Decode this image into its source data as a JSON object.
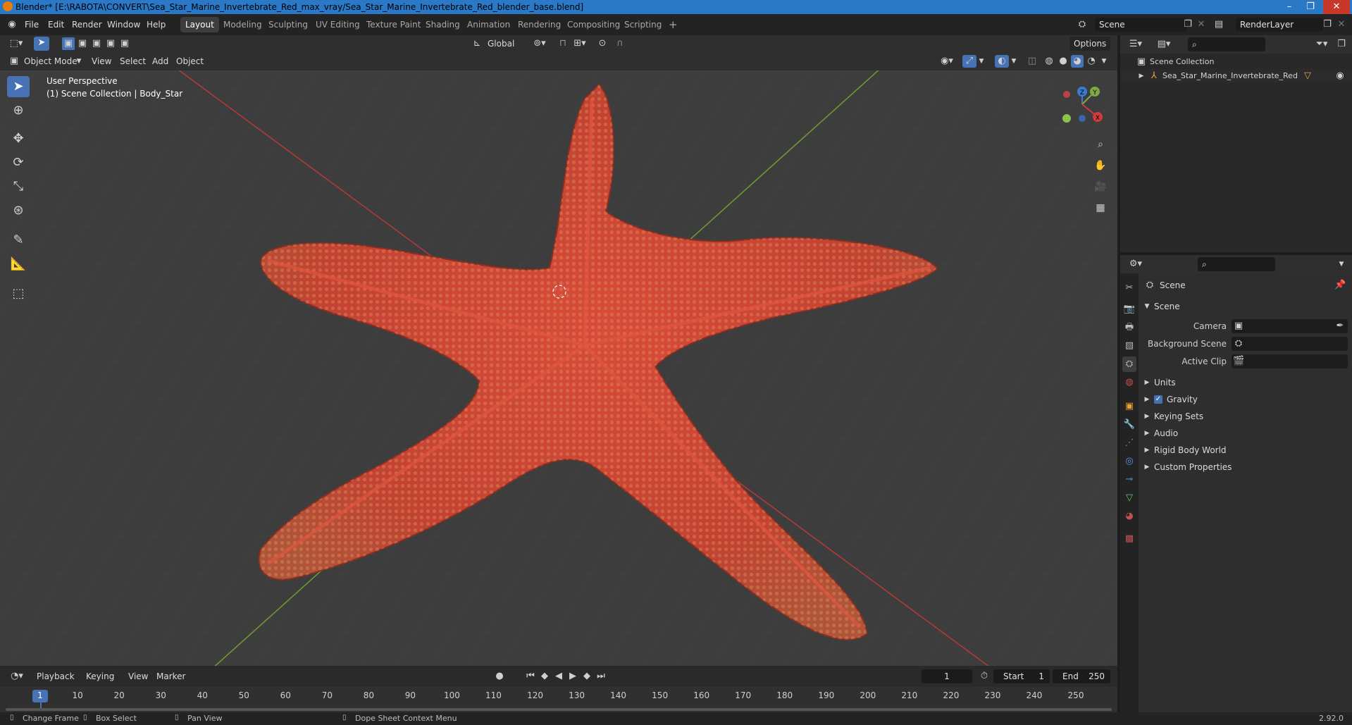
{
  "window": {
    "title": "Blender* [E:\\RABOTA\\CONVERT\\Sea_Star_Marine_Invertebrate_Red_max_vray/Sea_Star_Marine_Invertebrate_Red_blender_base.blend]",
    "controls": [
      "–",
      "❐",
      "✕"
    ]
  },
  "menu": {
    "items": [
      "File",
      "Edit",
      "Render",
      "Window",
      "Help"
    ]
  },
  "workspaces": {
    "tabs": [
      "Layout",
      "Modeling",
      "Sculpting",
      "UV Editing",
      "Texture Paint",
      "Shading",
      "Animation",
      "Rendering",
      "Compositing",
      "Scripting"
    ],
    "active": "Layout",
    "add": "+"
  },
  "scene_selector": {
    "scene": "Scene",
    "layer": "RenderLayer"
  },
  "viewport_header": {
    "orientation": "Global",
    "options": "Options",
    "mode": "Object Mode",
    "menus": [
      "View",
      "Select",
      "Add",
      "Object"
    ]
  },
  "viewport": {
    "perspective": "User Perspective",
    "collection_info": "(1) Scene Collection | Body_Star",
    "gizmo": {
      "x": "X",
      "y": "Y",
      "z": "Z"
    },
    "object_color": "#c9433a",
    "grid_x_color": "#b03a3a",
    "grid_y_color": "#6b9a2e"
  },
  "outliner": {
    "root": "Scene Collection",
    "items": [
      {
        "name": "Sea_Star_Marine_Invertebrate_Red"
      }
    ]
  },
  "properties": {
    "context": "Scene",
    "section": "Scene",
    "fields": [
      {
        "label": "Camera",
        "value": ""
      },
      {
        "label": "Background Scene",
        "value": ""
      },
      {
        "label": "Active Clip",
        "value": ""
      }
    ],
    "panels": [
      {
        "label": "Units"
      },
      {
        "label": "Gravity",
        "checkbox": true
      },
      {
        "label": "Keying Sets"
      },
      {
        "label": "Audio"
      },
      {
        "label": "Rigid Body World"
      },
      {
        "label": "Custom Properties"
      }
    ]
  },
  "timeline": {
    "menus": [
      "Playback",
      "Keying",
      "View",
      "Marker"
    ],
    "current_frame": "1",
    "start_label": "Start",
    "start": "1",
    "end_label": "End",
    "end": "250",
    "ticks": [
      "1",
      "10",
      "20",
      "30",
      "40",
      "50",
      "60",
      "70",
      "80",
      "90",
      "100",
      "110",
      "120",
      "130",
      "140",
      "150",
      "160",
      "170",
      "180",
      "190",
      "200",
      "210",
      "220",
      "230",
      "240",
      "250"
    ]
  },
  "statusbar": {
    "items": [
      "Change Frame",
      "Box Select",
      "Pan View",
      "Dope Sheet Context Menu"
    ],
    "version": "2.92.0"
  }
}
